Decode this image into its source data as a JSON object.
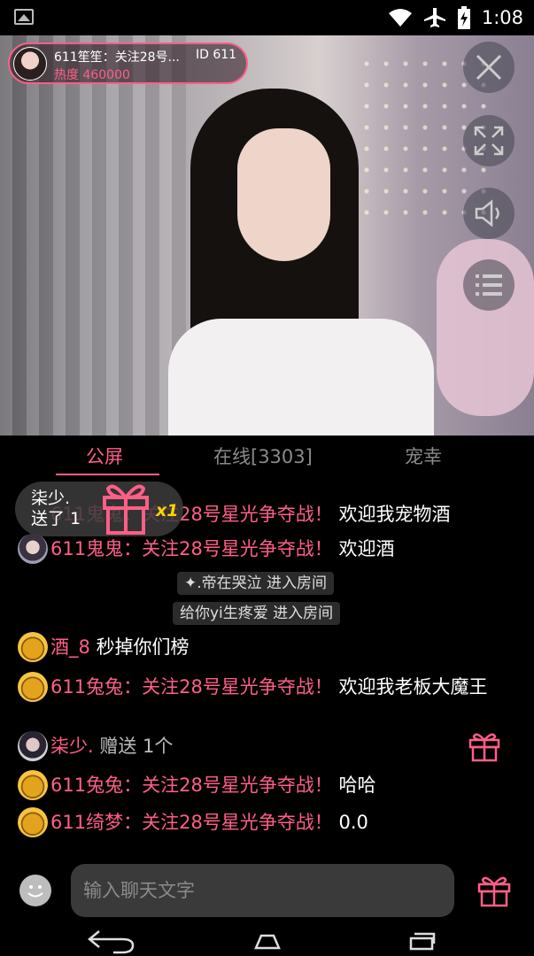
{
  "status_bar": {
    "time": "1:08"
  },
  "stream": {
    "host_name": "611笙笙：关注28号...",
    "host_id": "ID 611",
    "heat": "热度 460000"
  },
  "tabs": [
    {
      "label": "公屏",
      "active": true
    },
    {
      "label": "在线[3303]",
      "active": false
    },
    {
      "label": "宠幸",
      "active": false
    }
  ],
  "gift_popup": {
    "line1": "柒少.",
    "line2": "送了 1",
    "count": "x1"
  },
  "chat": {
    "partial_top": {
      "name": "611鬼鬼：关注28号星光争夺战！",
      "text": "欢迎我宠物酒"
    },
    "m1": {
      "name": "611鬼鬼：关注28号星光争夺战！",
      "text": "欢迎酒"
    },
    "sys1": "✦.帝在哭泣 进入房间",
    "sys2": "给你yi生疼爱 进入房间",
    "m2": {
      "name": "酒_8",
      "text": "秒掉你们榜"
    },
    "m3": {
      "name": "611兔兔：关注28号星光争夺战！",
      "text": "欢迎我老板大魔王"
    },
    "m4": {
      "name": "柒少.",
      "text": "赠送 1个"
    },
    "m5": {
      "name": "611兔兔：关注28号星光争夺战！",
      "text": "哈哈"
    },
    "m6": {
      "name": "611绮梦：关注28号星光争夺战！",
      "text": "0.0"
    }
  },
  "input": {
    "placeholder": "输入聊天文字"
  },
  "colors": {
    "accent": "#ff5f87",
    "background": "#000000",
    "gift_count": "#ffd400"
  },
  "icons": [
    "image-icon",
    "wifi-icon",
    "airplane-icon",
    "battery-icon",
    "close-icon",
    "fullscreen-icon",
    "volume-icon",
    "menu-icon",
    "gift-icon",
    "emoji-icon",
    "back-icon",
    "home-icon",
    "recents-icon"
  ]
}
